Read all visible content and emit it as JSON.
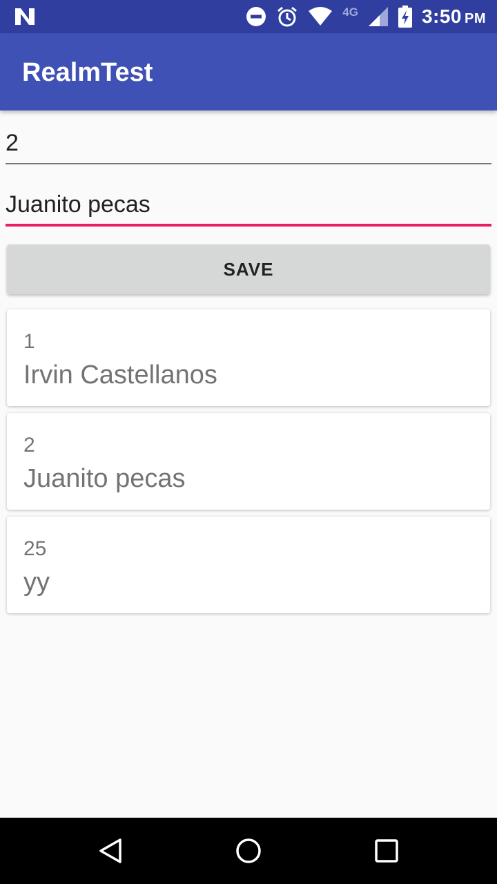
{
  "status_bar": {
    "time": "3:50",
    "ampm": "PM",
    "network": "4G",
    "icons": [
      "n-notification-icon",
      "dnd-icon",
      "alarm-icon",
      "wifi-icon",
      "signal-icon",
      "battery-charging-icon"
    ]
  },
  "app_bar": {
    "title": "RealmTest"
  },
  "form": {
    "id_value": "2",
    "name_value": "Juanito pecas",
    "save_label": "SAVE"
  },
  "list": {
    "items": [
      {
        "id": "1",
        "name": "Irvin Castellanos"
      },
      {
        "id": "2",
        "name": "Juanito pecas"
      },
      {
        "id": "25",
        "name": "yy"
      }
    ]
  },
  "nav_bar": {
    "icons": [
      "back-icon",
      "home-icon",
      "recents-icon"
    ]
  },
  "colors": {
    "status_bar": "#303f9f",
    "app_bar": "#3f51b5",
    "accent": "#e91e63",
    "button": "#d6d7d7"
  }
}
